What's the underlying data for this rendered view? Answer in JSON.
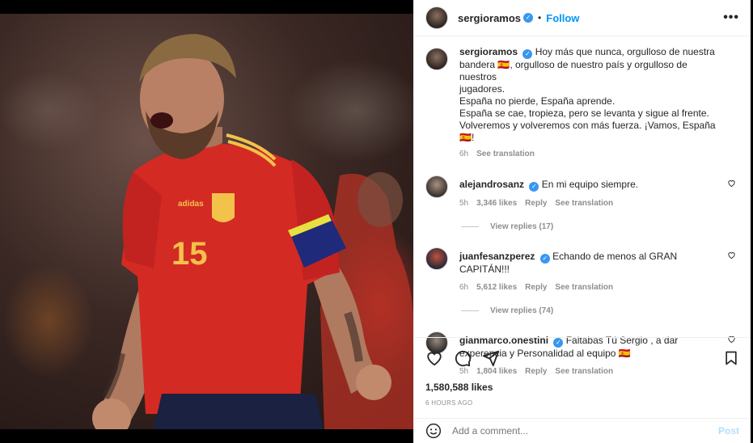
{
  "post": {
    "author": "sergioramos",
    "follow_label": "Follow",
    "dot": "•",
    "more_label": "•••",
    "verified_mark": "✓",
    "caption_lines": [
      "Hoy más que nunca, orgulloso de nuestra",
      "bandera 🇪🇸, orgulloso de nuestro país y orgulloso de nuestros",
      "jugadores.",
      "España no pierde, España aprende.",
      "España se cae, tropieza, pero se levanta y sigue al frente.",
      "Volveremos y volveremos con más fuerza. ¡Vamos, España 🇪🇸!"
    ],
    "caption_time": "6h",
    "see_translation": "See translation",
    "likes": "1,580,588 likes",
    "posted": "6 HOURS AGO"
  },
  "photo": {
    "jersey_number": "15",
    "brand": "adidas",
    "icon": "player-photo"
  },
  "comments": [
    {
      "user": "alejandrosanz",
      "text": "En mi equipo siempre.",
      "time": "5h",
      "likes": "3,346 likes",
      "reply": "Reply",
      "translate": "See translation",
      "replies": "View replies (17)"
    },
    {
      "user": "juanfesanzperez",
      "text": "Echando de menos al GRAN CAPITÁN!!!",
      "time": "6h",
      "likes": "5,612 likes",
      "reply": "Reply",
      "translate": "See translation",
      "replies": "View replies (74)"
    },
    {
      "user": "gianmarco.onestini",
      "text": "Faltabas Tú Sergio , a dar experencia y Personalidad al equipo 🇪🇸",
      "time": "5h",
      "likes": "1,804 likes",
      "reply": "Reply",
      "translate": "See translation"
    }
  ],
  "composer": {
    "placeholder": "Add a comment...",
    "post_label": "Post"
  },
  "colors": {
    "accent": "#0095f6",
    "verified": "#3897f0",
    "muted": "#8e8e8e",
    "jersey": "#d42a24"
  }
}
